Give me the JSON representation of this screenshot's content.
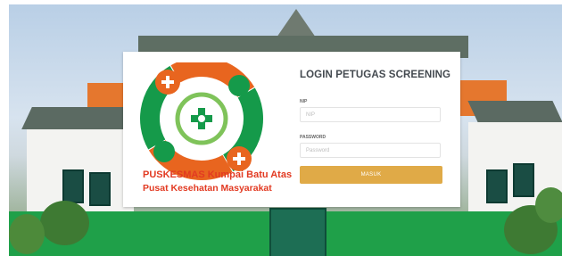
{
  "logo": {
    "caption_line1": "PUSKESMAS Kumpai Batu Atas",
    "caption_line2": "Pusat Kesehatan Masyarakat",
    "colors": {
      "orange": "#e8651f",
      "green": "#159a4a",
      "light_green": "#7fc35a"
    }
  },
  "form": {
    "title": "LOGIN PETUGAS SCREENING",
    "nip_label": "NIP",
    "nip_placeholder": "NIP",
    "password_label": "PASSWORD",
    "password_placeholder": "Password",
    "submit_label": "MASUK"
  },
  "colors": {
    "button": "#e0aa47",
    "card": "#ffffff"
  }
}
